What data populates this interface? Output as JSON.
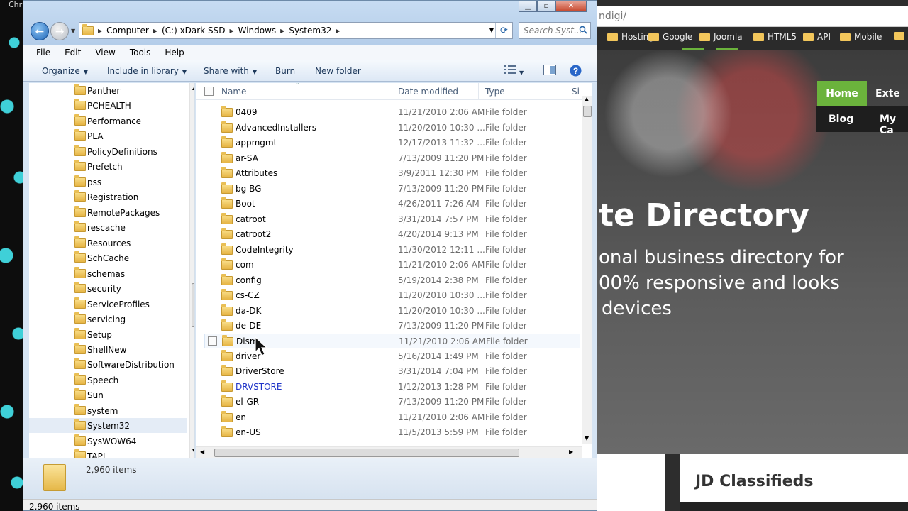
{
  "desktop": {
    "title_fragment": "Chr"
  },
  "browser": {
    "address": "ndigi/",
    "bookmarks": [
      "Hosting",
      "Google",
      "Joomla",
      "HTML5",
      "API",
      "Mobile"
    ],
    "nav": {
      "home": "Home",
      "ext": "Exte",
      "blog": "Blog",
      "myca": "My Ca"
    },
    "hero_title": "te Directory",
    "hero_lines": [
      "onal business directory for",
      "00% responsive and looks",
      "devices"
    ],
    "card_title": "JD Classifieds"
  },
  "explorer": {
    "breadcrumbs": [
      "Computer",
      "(C:) xDark SSD",
      "Windows",
      "System32"
    ],
    "search_placeholder": "Search Syst...",
    "menu": [
      "File",
      "Edit",
      "View",
      "Tools",
      "Help"
    ],
    "toolbar": {
      "organize": "Organize",
      "include": "Include in library",
      "share": "Share with",
      "burn": "Burn",
      "new_folder": "New folder"
    },
    "nav_items": [
      "Panther",
      "PCHEALTH",
      "Performance",
      "PLA",
      "PolicyDefinitions",
      "Prefetch",
      "pss",
      "Registration",
      "RemotePackages",
      "rescache",
      "Resources",
      "SchCache",
      "schemas",
      "security",
      "ServiceProfiles",
      "servicing",
      "Setup",
      "ShellNew",
      "SoftwareDistribution",
      "Speech",
      "Sun",
      "system",
      "System32",
      "SysWOW64",
      "TAPI"
    ],
    "columns": {
      "name": "Name",
      "date": "Date modified",
      "type": "Type",
      "size": "Si"
    },
    "files": [
      {
        "name": "0409",
        "date": "11/21/2010 2:06 AM",
        "type": "File folder"
      },
      {
        "name": "AdvancedInstallers",
        "date": "11/20/2010 10:30 ...",
        "type": "File folder"
      },
      {
        "name": "appmgmt",
        "date": "12/17/2013 11:32 ...",
        "type": "File folder"
      },
      {
        "name": "ar-SA",
        "date": "7/13/2009 11:20 PM",
        "type": "File folder"
      },
      {
        "name": "Attributes",
        "date": "3/9/2011 12:30 PM",
        "type": "File folder"
      },
      {
        "name": "bg-BG",
        "date": "7/13/2009 11:20 PM",
        "type": "File folder"
      },
      {
        "name": "Boot",
        "date": "4/26/2011 7:26 AM",
        "type": "File folder"
      },
      {
        "name": "catroot",
        "date": "3/31/2014 7:57 PM",
        "type": "File folder"
      },
      {
        "name": "catroot2",
        "date": "4/20/2014 9:13 PM",
        "type": "File folder"
      },
      {
        "name": "CodeIntegrity",
        "date": "11/30/2012 12:11 ...",
        "type": "File folder"
      },
      {
        "name": "com",
        "date": "11/21/2010 2:06 AM",
        "type": "File folder"
      },
      {
        "name": "config",
        "date": "5/19/2014 2:38 PM",
        "type": "File folder"
      },
      {
        "name": "cs-CZ",
        "date": "11/20/2010 10:30 ...",
        "type": "File folder"
      },
      {
        "name": "da-DK",
        "date": "11/20/2010 10:30 ...",
        "type": "File folder"
      },
      {
        "name": "de-DE",
        "date": "7/13/2009 11:20 PM",
        "type": "File folder"
      },
      {
        "name": "Dism",
        "date": "11/21/2010 2:06 AM",
        "type": "File folder"
      },
      {
        "name": "driver",
        "date": "5/16/2014 1:49 PM",
        "type": "File folder"
      },
      {
        "name": "DriverStore",
        "date": "3/31/2014 7:04 PM",
        "type": "File folder"
      },
      {
        "name": "DRVSTORE",
        "date": "1/12/2013 1:28 PM",
        "type": "File folder"
      },
      {
        "name": "el-GR",
        "date": "7/13/2009 11:20 PM",
        "type": "File folder"
      },
      {
        "name": "en",
        "date": "11/21/2010 2:06 AM",
        "type": "File folder"
      },
      {
        "name": "en-US",
        "date": "11/5/2013 5:59 PM",
        "type": "File folder"
      }
    ],
    "item_count": "2,960 items",
    "status_count": "2,960 items"
  }
}
